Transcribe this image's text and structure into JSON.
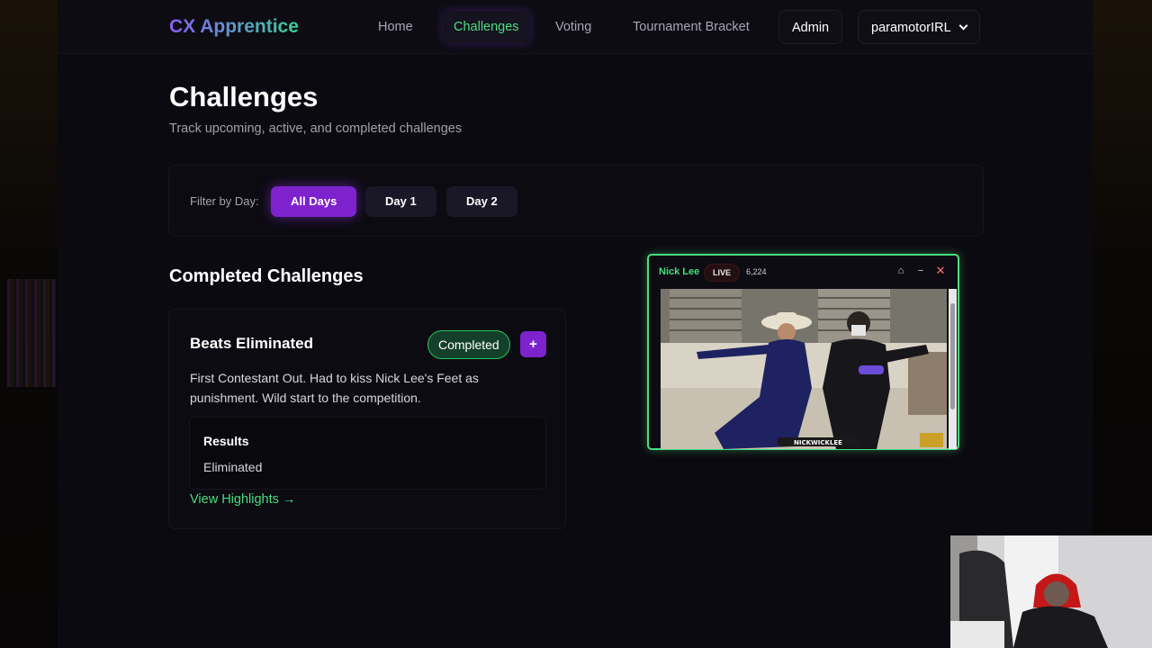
{
  "nav": {
    "brand": "CX Apprentice",
    "links": [
      "Home",
      "Challenges",
      "Voting",
      "Tournament Bracket"
    ],
    "admin": "Admin",
    "user": "paramotorIRL"
  },
  "page": {
    "title": "Challenges",
    "subtitle": "Track upcoming, active, and completed challenges"
  },
  "filter": {
    "label": "Filter by Day:",
    "options": [
      "All Days",
      "Day 1",
      "Day 2"
    ],
    "active": "All Days"
  },
  "section": {
    "title": "Completed Challenges"
  },
  "challenge": {
    "title": "Beats Eliminated",
    "status": "Completed",
    "plus": "+",
    "description": "First Contestant Out. Had to kiss Nick Lee's Feet as punishment. Wild start to the competition.",
    "results_label": "Results",
    "results_value": "Eliminated",
    "highlights_link": "View Highlights →"
  },
  "stream": {
    "name": "Nick Lee",
    "live": "LIVE",
    "viewers": "6,224",
    "icons": [
      "home-icon",
      "minimize-icon",
      "close-icon"
    ],
    "home_glyph": "⌂",
    "min_glyph": "−",
    "close_glyph": "✕",
    "watermark": "NICKWICKLEE"
  },
  "colors": {
    "accent_green": "#4ade80",
    "accent_purple": "#7e22ce",
    "background": "#0b0a10"
  }
}
